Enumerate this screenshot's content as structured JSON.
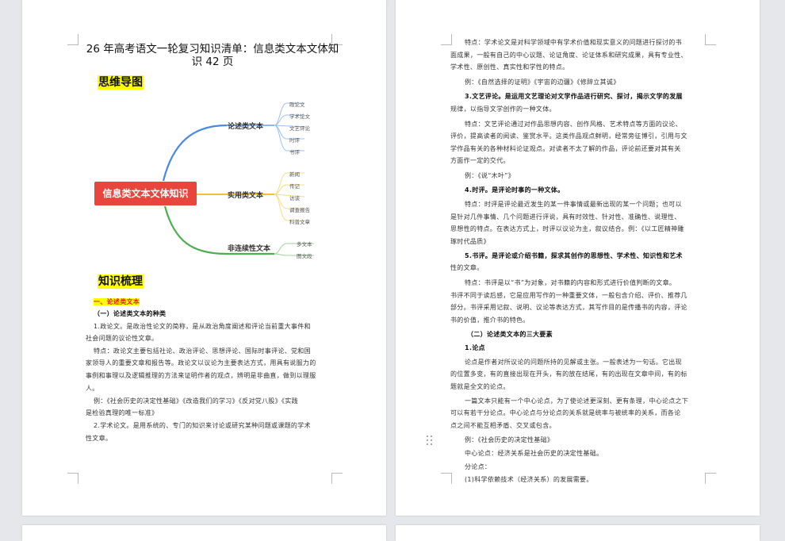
{
  "page1": {
    "title": "26 年高考语文一轮复习知识清单：信息类文本文体知识 42 页",
    "section1": "思维导图",
    "mindmap": {
      "root": "信息类文本文体知识",
      "branches": [
        {
          "label": "论述类文本",
          "leaves": [
            "政论文",
            "学术论文",
            "文艺评论",
            "时评",
            "书评"
          ]
        },
        {
          "label": "实用类文本",
          "leaves": [
            "新闻",
            "传记",
            "访谈",
            "调查报告",
            "科普文章"
          ]
        },
        {
          "label": "非连续性文本",
          "leaves": [
            "多文本",
            "图文段"
          ]
        }
      ]
    },
    "section2": "知识梳理",
    "h1": "一、论述类文本",
    "h2": "（一）论述类文本的种类",
    "p1": "1.政论文。是政治性论文的简称，是从政治角度阐述和评论当前重大事件和",
    "p1b": "社会问题的议论性文章。",
    "p2": "特点：政论文主要包括社论、政治评论、思想评论、国际时事评论、党和国",
    "p2b": "家领导人的重要文章和报告等。政论文以议论为主要表达方式，用具有说服力的",
    "p2c": "事例和事理以及逻辑推理的方法来证明作者的观点，辨明是非曲直，做到以理服",
    "p2d": "人。",
    "p3": "例：《社会历史的决定性基础》《改造我们的学习》《反对党八股》《实践",
    "p3b": "是检验真理的唯一标准》",
    "p4": "2.学术论文。是用系统的、专门的知识来讨论或研究某种问题或课题的学术",
    "p4b": "性文章。"
  },
  "page2": {
    "lines": [
      "特点：学术论文是对科学领域中有学术价值和现实意义的问题进行探讨的书",
      "面成果，一般有自己的中心议题、论证角度、论证体系和研究成果，具有专业性、",
      "学术性、原创性、真实性和学性的特点。",
      "例：《自然选择的证明》《宇宙的边疆》《修辞立其诚》",
      "3.文艺评论。是运用文艺理论对文学作品进行研究、探讨，揭示文学的发展",
      "规律，以指导文学创作的一种文体。",
      "特点：文艺评论通过对作品思想内容、创作风格、艺术特点等方面的议论、",
      "评价，提高读者的阅读、鉴赏水平。这类作品观点鲜明，经常旁征博引，引用与文",
      "学作品有关的各种材料论证观点。对读者不太了解的作品，评论前还要对其有关",
      "方面作一定的交代。",
      "例：《说“木叶”》",
      "4.时评。是评论时事的一种文体。",
      "特点：时评是评论最近发生的某一件事情或最新出现的某一个问题；也可以",
      "是针对几件事情、几个问题进行评说，具有时效性、针对性、准确性、说理性、",
      "思想性的特点。在表达方式上，时评以议论为主，叙议结合。例：《以工匠精神雕",
      "琢时代品质》",
      "5.书评。是评论或介绍书籍，探求其创作的思想性、学术性、知识性和艺术",
      "性的文章。",
      "特点：书评是以“书”为对象，对书籍的内容和形式进行价值判断的文章。",
      "书评不同于读后感，它是应用写作的一种重要文体，一般包含介绍、评价、推荐几",
      "部分。书评采用记叙、说明、议论等表达方式，其写作目的是传播书的内容，评论",
      "书的价值，推介书的特色。",
      "（二）论述类文本的三大要素",
      "1.论点",
      "论点是作者对所议论的问题所持的见解或主张。一般表述为一句话。它出现",
      "的位置多变，有的直接出现在开头，有的放在结尾，有的出现在文章中间，有的标",
      "题就是全文的论点。",
      "一篇文本只能有一个中心论点，为了使论述更深刻、更有条理，中心论点之下",
      "可以有若干分论点。中心论点与分论点的关系就是统率与被统率的关系，而各论",
      "点之间不能互相矛盾、交叉或包含。",
      "例：《社会历史的决定性基础》",
      "中心论点：经济关系是社会历史的决定性基础。",
      "分论点：",
      "(1)科学依赖技术（经济关系）的发展需要。"
    ]
  }
}
